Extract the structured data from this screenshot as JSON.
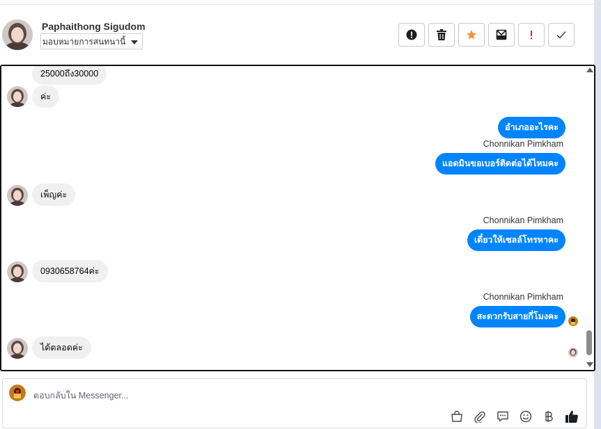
{
  "header": {
    "contact_name": "Paphaithong Sigudom",
    "assign_label": "มอบหมายการสนทนานี้"
  },
  "actions": [
    {
      "icon": "alert-circle-icon"
    },
    {
      "icon": "trash-icon"
    },
    {
      "icon": "star-icon",
      "color": "#f7923a"
    },
    {
      "icon": "archive-icon"
    },
    {
      "icon": "exclamation-icon",
      "color": "#e4222b"
    },
    {
      "icon": "check-icon"
    }
  ],
  "messages": {
    "m1": "25000ถึง30000",
    "m2": "ค่ะ",
    "m3": "อำเภออะไรคะ",
    "m4_sender": "Chonnikan Pimkham",
    "m4": "แอดมินขอเบอร์ติดต่อได้ไหมคะ",
    "m5": "เพ็ญค่ะ",
    "m6_sender": "Chonnikan Pimkham",
    "m6": "เดี๋ยวให้เซลล์โทรหาคะ",
    "m7": "0930658764ค่ะ",
    "m8_sender": "Chonnikan Pimkham",
    "m8": "สะดวกรับสายกี่โมงคะ",
    "m9": "ได้ตลอดค่ะ"
  },
  "composer": {
    "placeholder": "ตอบกลับใน Messenger..."
  },
  "colors": {
    "outgoing_bubble": "#0084ff",
    "incoming_bubble": "#f0f0f0",
    "like_icon": "#1c1e21"
  }
}
